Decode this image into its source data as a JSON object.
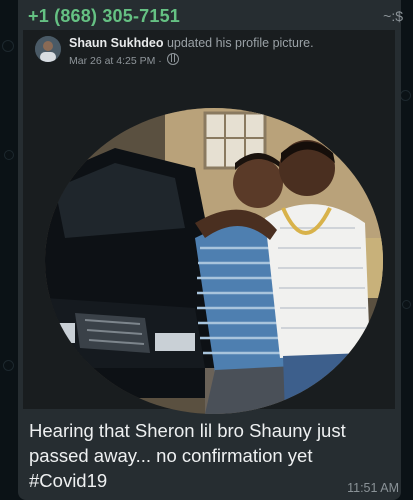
{
  "message": {
    "sender_phone": "+1 (868) 305-7151",
    "sender_alias": "~:$",
    "caption_lines": [
      "Hearing that Sheron lil bro Shauny just",
      "passed away... no confirmation yet",
      "#Covid19"
    ],
    "time": "11:51 AM"
  },
  "shared_post": {
    "author": "Shaun Sukhdeo",
    "action": "updated his profile picture.",
    "date": "Mar 26 at 4:25 PM",
    "separator": "·",
    "privacy_icon": "globe-icon",
    "image_description": ""
  },
  "colors": {
    "sender_name": "#65c183",
    "bubble": "#262d31",
    "card": "#191d1f",
    "background": "#0b1216"
  }
}
